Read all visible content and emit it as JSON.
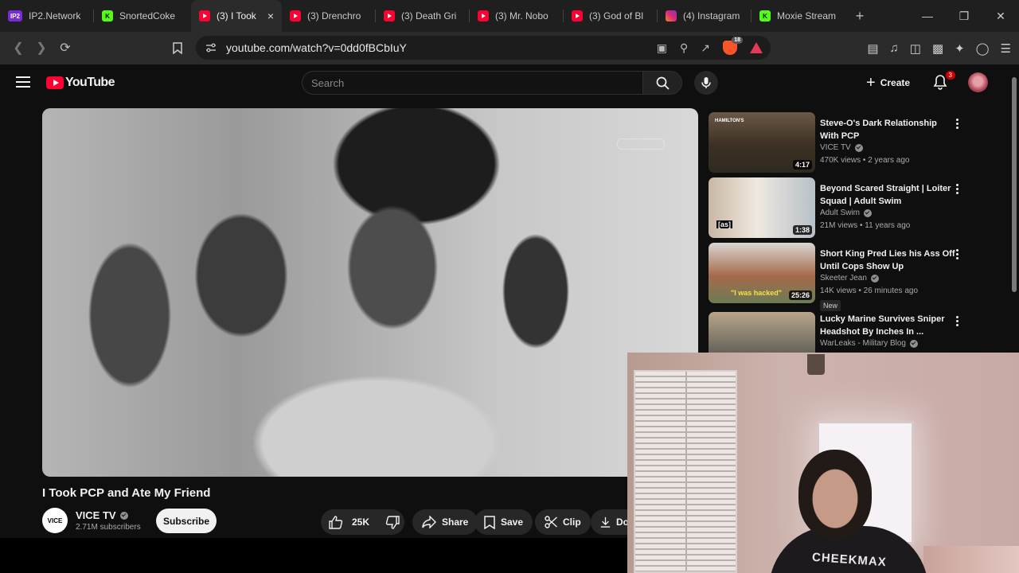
{
  "browser": {
    "tabs": [
      {
        "title": "IP2.Network",
        "favicon": "ip2-icon",
        "short": "IP2"
      },
      {
        "title": "SnortedCoke",
        "favicon": "kick-icon",
        "short": "K"
      },
      {
        "title": "(3) I Took",
        "favicon": "youtube-icon",
        "active": true
      },
      {
        "title": "(3) Drenchro",
        "favicon": "youtube-icon"
      },
      {
        "title": "(3) Death Gri",
        "favicon": "youtube-icon"
      },
      {
        "title": "(3) Mr. Nobo",
        "favicon": "youtube-icon"
      },
      {
        "title": "(3) God of Bl",
        "favicon": "youtube-icon"
      },
      {
        "title": "(4) Instagram",
        "favicon": "instagram-icon"
      },
      {
        "title": "Moxie Stream",
        "favicon": "kick-icon",
        "short": "K"
      }
    ],
    "new_tab": "+",
    "close_tab": "×",
    "url": "youtube.com/watch?v=0dd0fBCbIuY",
    "shields_count": "18"
  },
  "youtube": {
    "logo_text": "YouTube",
    "search_placeholder": "Search",
    "create_label": "Create",
    "notifications": "3"
  },
  "video": {
    "title": "I Took PCP and Ate My Friend",
    "channel": "VICE TV",
    "channel_avatar_text": "VICE",
    "subscribers": "2.71M subscribers",
    "subscribe_label": "Subscribe",
    "likes": "25K",
    "share_label": "Share",
    "save_label": "Save",
    "clip_label": "Clip",
    "download_label": "Do"
  },
  "recommendations": [
    {
      "title": "Steve-O's Dark Relationship With PCP",
      "channel": "VICE TV",
      "meta": "470K views • 2 years ago",
      "duration": "4:17",
      "verified": true,
      "thumb_text": "HAMILTON'S"
    },
    {
      "title": "Beyond Scared Straight | Loiter Squad | Adult Swim",
      "channel": "Adult Swim",
      "meta": "21M views • 11 years ago",
      "duration": "1:38",
      "verified": true,
      "thumb_text": "[as]"
    },
    {
      "title": "Short King Pred Lies his Ass Off Until Cops Show Up",
      "channel": "Skeeter Jean",
      "meta": "14K views • 26 minutes ago",
      "duration": "25:26",
      "verified": true,
      "badge": "New",
      "thumb_text": "\"I was hacked\""
    },
    {
      "title": "Lucky Marine Survives Sniper Headshot By Inches In ...",
      "channel": "WarLeaks - Military Blog",
      "meta": "",
      "duration": "",
      "verified": true
    }
  ],
  "webcam": {
    "shirt_text": "CHEEKMAX"
  },
  "colors": {
    "youtube_red": "#ff0033",
    "background": "#0f0f0f",
    "pill": "#272727"
  }
}
